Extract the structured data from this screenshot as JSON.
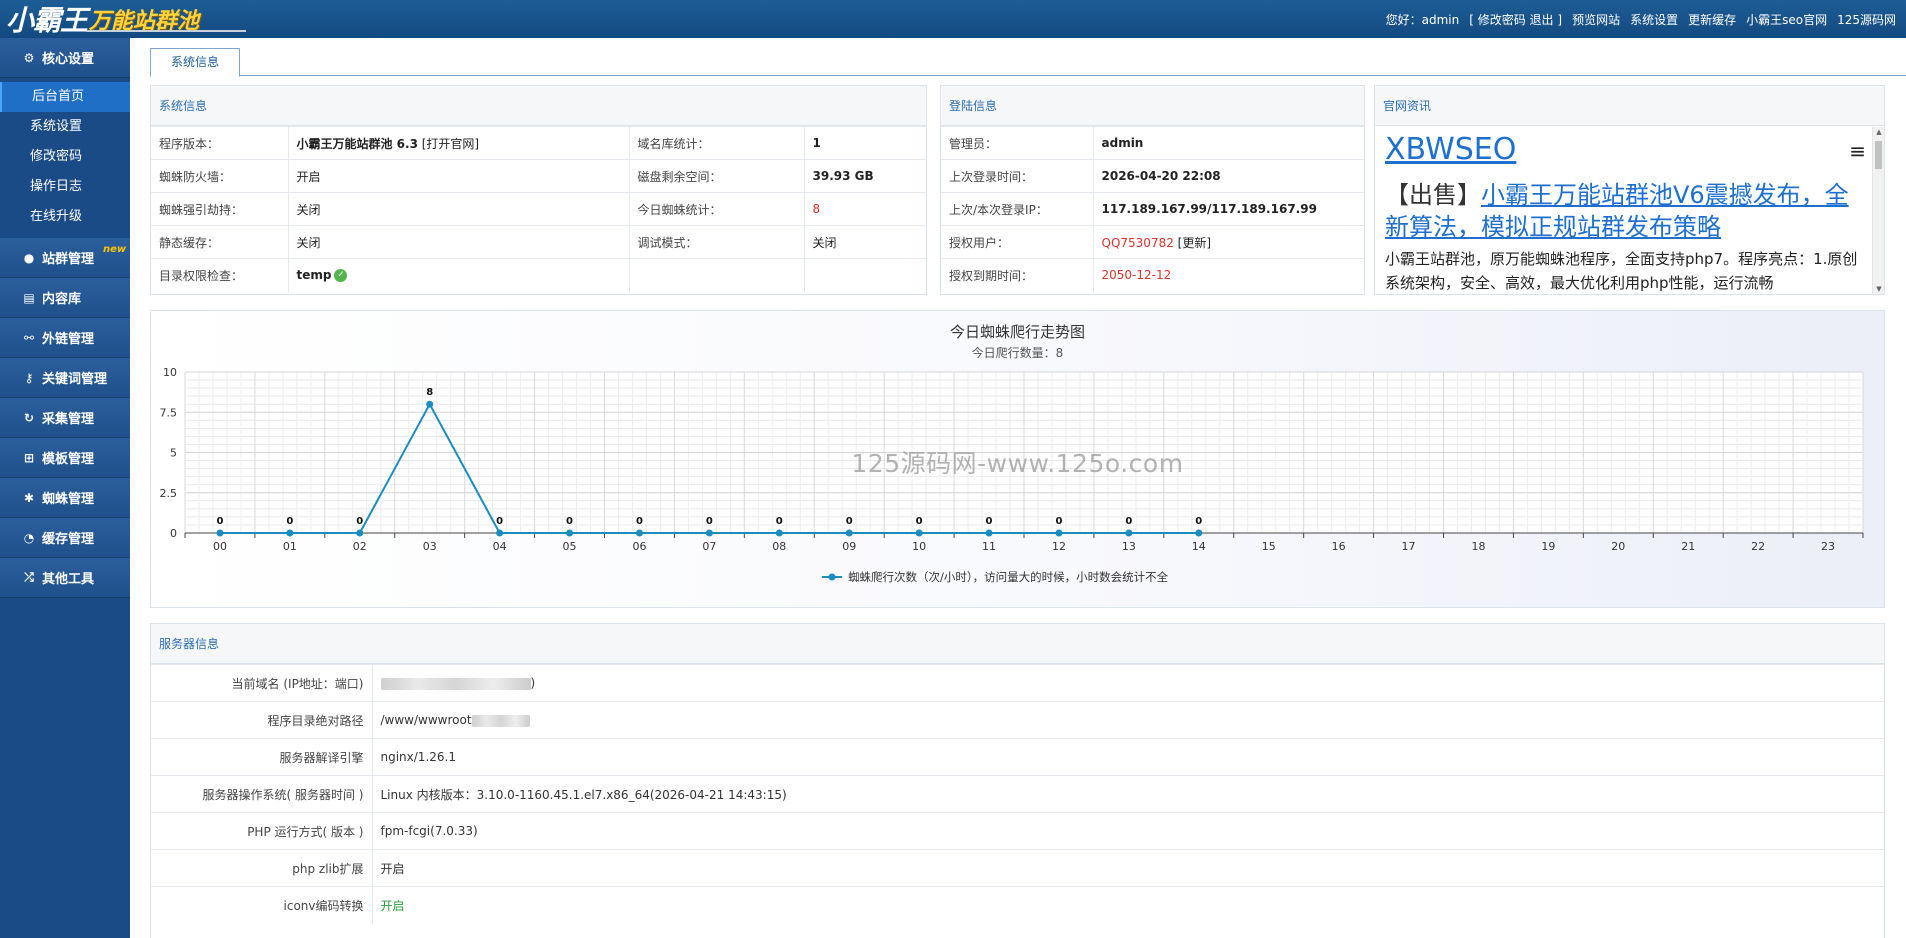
{
  "header": {
    "logo_main": "小霸王",
    "logo_sub": "万能站群池",
    "greeting": "您好：admin",
    "account_links": "[ 修改密码 退出 ]",
    "nav": [
      "预览网站",
      "系统设置",
      "更新缓存",
      "小霸王seo官网",
      "125源码网"
    ]
  },
  "sidebar": {
    "core": {
      "label": "核心设置",
      "icon": "gear-icon"
    },
    "core_items": [
      "后台首页",
      "系统设置",
      "修改密码",
      "操作日志",
      "在线升级"
    ],
    "groups": [
      {
        "label": "站群管理",
        "icon": "user-icon",
        "badge": "new"
      },
      {
        "label": "内容库",
        "icon": "document-icon"
      },
      {
        "label": "外链管理",
        "icon": "link-icon"
      },
      {
        "label": "关键词管理",
        "icon": "key-icon"
      },
      {
        "label": "采集管理",
        "icon": "refresh-icon"
      },
      {
        "label": "模板管理",
        "icon": "windows-icon"
      },
      {
        "label": "蜘蛛管理",
        "icon": "spider-icon"
      },
      {
        "label": "缓存管理",
        "icon": "dashboard-icon"
      },
      {
        "label": "其他工具",
        "icon": "shuffle-icon"
      }
    ]
  },
  "tab": {
    "label": "系统信息"
  },
  "system_info": {
    "title": "系统信息",
    "rows": [
      {
        "k1": "程序版本：",
        "v1": "小霸王万能站群池 6.3",
        "v1b": " [打开官网]",
        "k2": "域名库统计：",
        "v2": "1"
      },
      {
        "k1": "蜘蛛防火墙：",
        "v1": "开启",
        "v1b": "",
        "k2": "磁盘剩余空间：",
        "v2": "39.93 GB"
      },
      {
        "k1": "蜘蛛强引劫持：",
        "v1": "关闭",
        "v1b": "",
        "k2": "今日蜘蛛统计：",
        "v2": "8"
      },
      {
        "k1": "静态缓存：",
        "v1": "关闭",
        "v1b": "",
        "k2": "调试模式：",
        "v2": "关闭"
      },
      {
        "k1": "目录权限检查：",
        "v1": "temp",
        "v1b": "",
        "k2": "",
        "v2": ""
      }
    ]
  },
  "login_info": {
    "title": "登陆信息",
    "rows": [
      {
        "k": "管理员：",
        "v": "admin",
        "extra": ""
      },
      {
        "k": "上次登录时间：",
        "v": "2026-04-20 22:08",
        "extra": ""
      },
      {
        "k": "上次/本次登录IP：",
        "v": "117.189.167.99/117.189.167.99",
        "extra": ""
      },
      {
        "k": "授权用户：",
        "v": "QQ7530782",
        "extra": " [更新]"
      },
      {
        "k": "授权到期时间：",
        "v": "2050-12-12",
        "extra": ""
      }
    ]
  },
  "news": {
    "title": "官网资讯",
    "brand": "XBWSEO",
    "headline_prefix": "【出售】",
    "headline_link": "小霸王万能站群池V6震撼发布，全新算法，模拟正规站群发布策略",
    "text": "小霸王站群池，原万能蜘蛛池程序，全面支持php7。程序亮点：1.原创系统架构，安全、高效，最大优化利用php性能，运行流畅"
  },
  "watermark": "125源码网-www.125o.com",
  "chart_data": {
    "type": "line",
    "title": "今日蜘蛛爬行走势图",
    "subtitle": "今日爬行数量：8",
    "categories": [
      "00",
      "01",
      "02",
      "03",
      "04",
      "05",
      "06",
      "07",
      "08",
      "09",
      "10",
      "11",
      "12",
      "13",
      "14",
      "15",
      "16",
      "17",
      "18",
      "19",
      "20",
      "21",
      "22",
      "23"
    ],
    "series": [
      {
        "name": "蜘蛛爬行次数（次/小时），访问量大的时候，小时数会统计不全",
        "values": [
          0,
          0,
          0,
          8,
          0,
          0,
          0,
          0,
          0,
          0,
          0,
          0,
          0,
          0,
          0
        ],
        "color": "#1a8cc0"
      }
    ],
    "yticks": [
      "0",
      "2.5",
      "5",
      "7.5",
      "10"
    ],
    "ylim": [
      0,
      10
    ],
    "grid": true,
    "legend_position": "bottom"
  },
  "server_info": {
    "title": "服务器信息",
    "rows": [
      {
        "k": "当前域名 (IP地址：端口)",
        "v": ")"
      },
      {
        "k": "程序目录绝对路径",
        "v": "/www/wwwroot"
      },
      {
        "k": "服务器解译引擎",
        "v": "nginx/1.26.1"
      },
      {
        "k": "服务器操作系统( 服务器时间 )",
        "v": "Linux 内核版本：3.10.0-1160.45.1.el7.x86_64(2026-04-21 14:43:15)"
      },
      {
        "k": "PHP 运行方式( 版本 )",
        "v": "fpm-fcgi(7.0.33)"
      },
      {
        "k": "php zlib扩展",
        "v": "开启"
      },
      {
        "k": "iconv编码转换",
        "v": "开启"
      }
    ]
  }
}
